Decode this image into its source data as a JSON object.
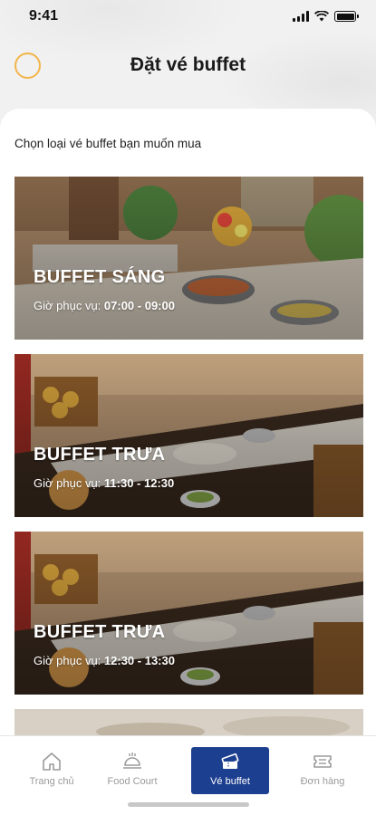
{
  "status": {
    "time": "9:41"
  },
  "header": {
    "title": "Đặt vé buffet"
  },
  "main": {
    "subtitle": "Chọn loại vé buffet bạn muốn mua",
    "cards": [
      {
        "name": "BUFFET SÁNG",
        "hours_label": "Giờ phục vụ: ",
        "hours": "07:00 - 09:00"
      },
      {
        "name": "BUFFET TRƯA",
        "hours_label": "Giờ phục vụ: ",
        "hours": "11:30 - 12:30"
      },
      {
        "name": "BUFFET TRƯA",
        "hours_label": "Giờ phục vụ: ",
        "hours": "12:30 - 13:30"
      }
    ]
  },
  "nav": {
    "items": [
      {
        "label": "Trang chủ",
        "icon": "home-icon"
      },
      {
        "label": "Food Court",
        "icon": "food-tray-icon"
      },
      {
        "label": "Vé buffet",
        "icon": "ticket-icon",
        "active": true
      },
      {
        "label": "Đơn hàng",
        "icon": "order-icon"
      }
    ],
    "active_color": "#1d3f8f"
  },
  "colors": {
    "accent": "#f2b54a",
    "nav_active": "#1d3f8f"
  }
}
